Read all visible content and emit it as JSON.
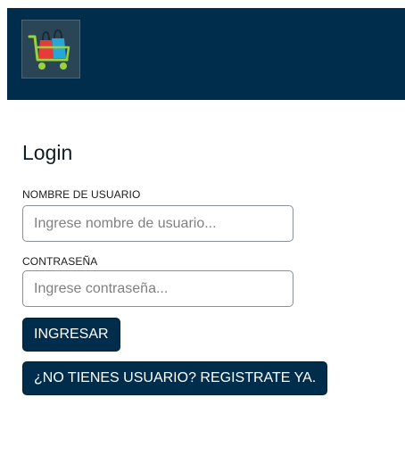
{
  "header": {
    "logo_icon": "shopping-cart-bags-icon"
  },
  "login": {
    "title": "Login",
    "username": {
      "label": "NOMBRE DE USUARIO",
      "placeholder": "Ingrese nombre de usuario...",
      "value": ""
    },
    "password": {
      "label": "CONTRASEÑA",
      "placeholder": "Ingrese contraseña...",
      "value": ""
    },
    "submit_label": "INGRESAR",
    "register_label": "¿NO TIENES USUARIO? REGISTRATE YA."
  },
  "colors": {
    "navbar": "#002d4b",
    "button": "#002d4b",
    "button_text": "#ffffff"
  }
}
